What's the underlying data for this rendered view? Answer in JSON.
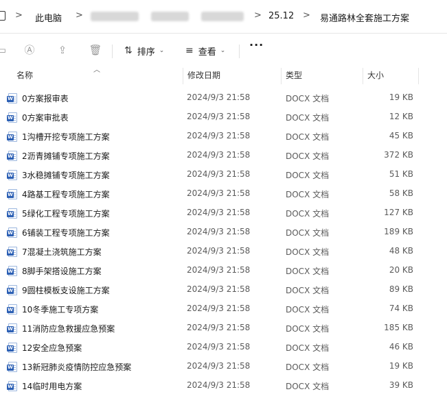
{
  "breadcrumb": {
    "items": [
      "此电脑",
      "25.12",
      "易通路林全套施工方案"
    ],
    "separator": ">"
  },
  "toolbar": {
    "sort_label": "排序",
    "view_label": "查看",
    "more_label": "···"
  },
  "columns": {
    "name": "名称",
    "date": "修改日期",
    "type": "类型",
    "size": "大小"
  },
  "files": [
    {
      "name": "0方案报审表",
      "date": "2024/9/3 21:58",
      "type": "DOCX 文档",
      "size": "19 KB"
    },
    {
      "name": "0方案审批表",
      "date": "2024/9/3 21:58",
      "type": "DOCX 文档",
      "size": "12 KB"
    },
    {
      "name": "1沟槽开挖专项施工方案",
      "date": "2024/9/3 21:58",
      "type": "DOCX 文档",
      "size": "45 KB"
    },
    {
      "name": "2沥青摊铺专项施工方案",
      "date": "2024/9/3 21:58",
      "type": "DOCX 文档",
      "size": "372 KB"
    },
    {
      "name": "3水稳摊铺专项施工方案",
      "date": "2024/9/3 21:58",
      "type": "DOCX 文档",
      "size": "51 KB"
    },
    {
      "name": "4路基工程专项施工方案",
      "date": "2024/9/3 21:58",
      "type": "DOCX 文档",
      "size": "58 KB"
    },
    {
      "name": "5绿化工程专项施工方案",
      "date": "2024/9/3 21:58",
      "type": "DOCX 文档",
      "size": "127 KB"
    },
    {
      "name": "6铺装工程专项施工方案",
      "date": "2024/9/3 21:58",
      "type": "DOCX 文档",
      "size": "189 KB"
    },
    {
      "name": "7混凝土浇筑施工方案",
      "date": "2024/9/3 21:58",
      "type": "DOCX 文档",
      "size": "48 KB"
    },
    {
      "name": "8脚手架搭设施工方案",
      "date": "2024/9/3 21:58",
      "type": "DOCX 文档",
      "size": "20 KB"
    },
    {
      "name": "9圆柱模板支设施工方案",
      "date": "2024/9/3 21:58",
      "type": "DOCX 文档",
      "size": "89 KB"
    },
    {
      "name": "10冬季施工专项方案",
      "date": "2024/9/3 21:58",
      "type": "DOCX 文档",
      "size": "74 KB"
    },
    {
      "name": "11消防应急救援应急预案",
      "date": "2024/9/3 21:58",
      "type": "DOCX 文档",
      "size": "185 KB"
    },
    {
      "name": "12安全应急预案",
      "date": "2024/9/3 21:58",
      "type": "DOCX 文档",
      "size": "46 KB"
    },
    {
      "name": "13新冠肺炎疫情防控应急预案",
      "date": "2024/9/3 21:58",
      "type": "DOCX 文档",
      "size": "19 KB"
    },
    {
      "name": "14临时用电方案",
      "date": "2024/9/3 21:58",
      "type": "DOCX 文档",
      "size": "39 KB"
    }
  ],
  "colors": {
    "word_icon": "#2b5fb4",
    "toolbar_disabled": "#9a9a9a",
    "divider": "#e5e5e5"
  }
}
